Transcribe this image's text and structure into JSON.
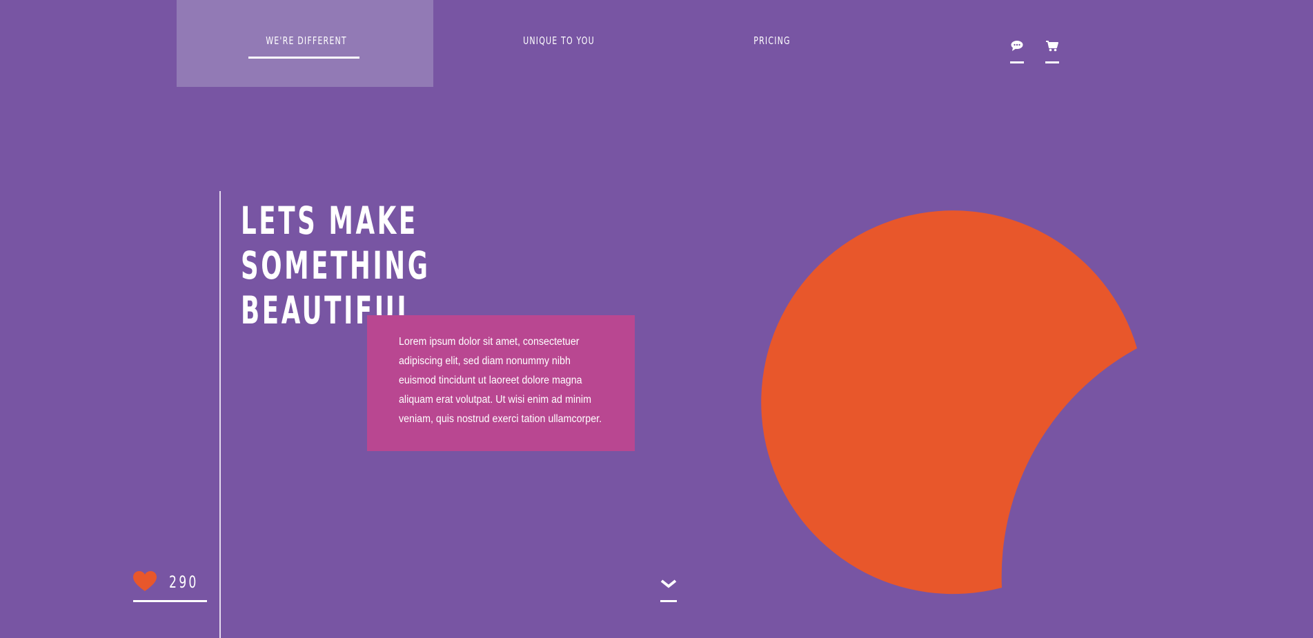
{
  "nav": {
    "items": [
      {
        "label": "WE'RE DIFFERENT",
        "active": true
      },
      {
        "label": "UNIQUE TO YOU",
        "active": false
      },
      {
        "label": "PRICING",
        "active": false
      }
    ],
    "icons": {
      "chat": "chat-bubble-icon",
      "cart": "shopping-cart-icon"
    },
    "active_background": "#927ab5"
  },
  "hero": {
    "headline_lines": [
      "LETS MAKE",
      "SOMETHING",
      "BEAUTIFUL."
    ],
    "body": "Lorem ipsum dolor sit amet, consectetuer adipiscing elit, sed diam nonummy nibh euismod tincidunt ut laoreet dolore magna aliquam erat volutpat. Ut wisi enim ad minim veniam, quis nostrud exerci tation ullamcorper."
  },
  "likes": {
    "count": "290",
    "icon": "heart-icon"
  },
  "scroll": {
    "icon": "chevron-down-icon"
  },
  "colors": {
    "background": "#7855a3",
    "accent_orange": "#e8572b",
    "text_box": "#b94791",
    "text": "#ffffff"
  }
}
